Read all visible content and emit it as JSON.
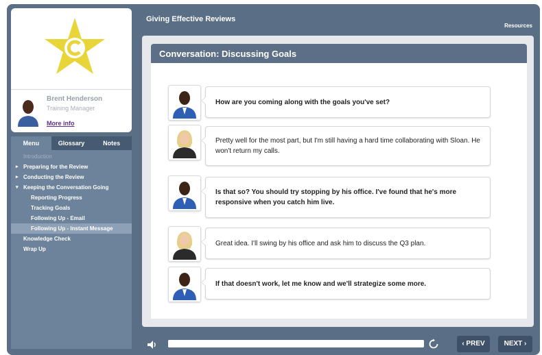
{
  "presenter": {
    "name": "Brent Henderson",
    "role": "Training Manager",
    "more_info_label": "More info"
  },
  "tabs": [
    {
      "label": "Menu",
      "active": true
    },
    {
      "label": "Glossary",
      "active": false
    },
    {
      "label": "Notes",
      "active": false
    }
  ],
  "menu": {
    "items": [
      {
        "label": "Introduction",
        "level": 0,
        "arrow": "",
        "state": "disabled"
      },
      {
        "label": "Preparing for the Review",
        "level": 0,
        "arrow": "▸",
        "state": "normal"
      },
      {
        "label": "Conducting the Review",
        "level": 0,
        "arrow": "▸",
        "state": "normal"
      },
      {
        "label": "Keeping the Conversation Going",
        "level": 0,
        "arrow": "▾",
        "state": "normal"
      },
      {
        "label": "Reporting Progress",
        "level": 1,
        "arrow": "",
        "state": "normal"
      },
      {
        "label": "Tracking Goals",
        "level": 1,
        "arrow": "",
        "state": "normal"
      },
      {
        "label": "Following Up - Email",
        "level": 1,
        "arrow": "",
        "state": "normal"
      },
      {
        "label": "Following Up - Instant Message",
        "level": 1,
        "arrow": "",
        "state": "selected"
      },
      {
        "label": "Knowledge Check",
        "level": 0,
        "arrow": "",
        "state": "normal"
      },
      {
        "label": "Wrap Up",
        "level": 0,
        "arrow": "",
        "state": "normal"
      }
    ]
  },
  "header": {
    "course_title": "Giving Effective Reviews",
    "resources_label": "Resources"
  },
  "scene": {
    "title": "Conversation: Discussing Goals",
    "messages": [
      {
        "speaker": "manager",
        "bold": true,
        "text": "How are you coming along with the goals you've set?"
      },
      {
        "speaker": "employee",
        "bold": false,
        "text": "Pretty well for the most part, but I'm still having a hard time collaborating with Sloan. He won't return my calls."
      },
      {
        "speaker": "manager",
        "bold": true,
        "text": "Is that so? You should try stopping by his office. I've found that he's more responsive when you catch him live."
      },
      {
        "speaker": "employee",
        "bold": false,
        "text": "Great idea. I'll swing by his office and ask him to discuss the Q3 plan."
      },
      {
        "speaker": "manager",
        "bold": true,
        "text": "If that doesn't work, let me know and we'll strategize some more."
      }
    ]
  },
  "player": {
    "audio_icon": "speaker-icon",
    "replay_icon": "replay-icon",
    "progress": 1.0,
    "prev_label": "‹ PREV",
    "next_label": "NEXT ›"
  },
  "colors": {
    "frame": "#5a6e86",
    "menu_panel": "#6d839c",
    "scene_header": "#5c6f86",
    "logo_star": "#e8d53a",
    "link": "#5b2d8e"
  }
}
